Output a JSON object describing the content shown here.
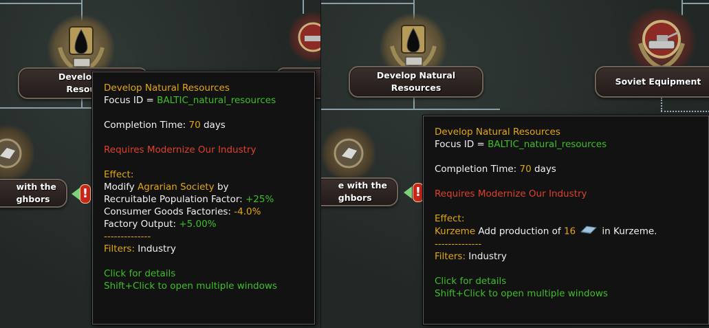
{
  "left": {
    "focus_main_label": "Develop N\nResour",
    "focus_left_label": "with the\nghbors",
    "tooltip": {
      "title": "Develop Natural Resources",
      "focus_id_label": "Focus ID = ",
      "focus_id_value": "BALTIC_natural_resources",
      "completion_prefix": "Completion Time: ",
      "completion_days": "70",
      "completion_suffix": " days",
      "requires": "Requires Modernize Our Industry",
      "effect_label": "Effect:",
      "modify_prefix": "Modify ",
      "modify_target": "Agrarian Society",
      "modify_suffix": " by",
      "mod1_label": "Recruitable Population Factor: ",
      "mod1_value": "+25%",
      "mod2_label": "Consumer Goods Factories: ",
      "mod2_value": "-4.0%",
      "mod3_label": "Factory Output: ",
      "mod3_value": "+5.00%",
      "separator": "--------------",
      "filters_label": "Filters:",
      "filters_value": " Industry",
      "hint1": "Click for details",
      "hint2": "Shift+Click to open multiple windows"
    }
  },
  "right": {
    "focus_main_label": "Develop Natural\nResources",
    "focus_equipment_label": "Soviet Equipment",
    "focus_left_label": "e with the\nghbors",
    "tooltip": {
      "title": "Develop Natural Resources",
      "focus_id_label": "Focus ID = ",
      "focus_id_value": "BALTIC_natural_resources",
      "completion_prefix": "Completion Time: ",
      "completion_days": "70",
      "completion_suffix": " days",
      "requires": "Requires Modernize Our Industry",
      "effect_label": "Effect:",
      "state_name": "Kurzeme",
      "production_text": " Add production of ",
      "production_amount": "16",
      "production_suffix": " in Kurzeme.",
      "separator": "--------------",
      "filters_label": "Filters:",
      "filters_value": " Industry",
      "hint1": "Click for details",
      "hint2": "Shift+Click to open multiple windows"
    }
  },
  "icons": {
    "oil": "oil-drop-icon",
    "tank": "tank-icon",
    "steel": "steel-ingot-icon",
    "warning": "exclamation-icon",
    "arrow": "arrow-left-icon"
  },
  "colors": {
    "gold": "#e2a814",
    "green": "#3fbf2a",
    "red": "#e0402a"
  }
}
